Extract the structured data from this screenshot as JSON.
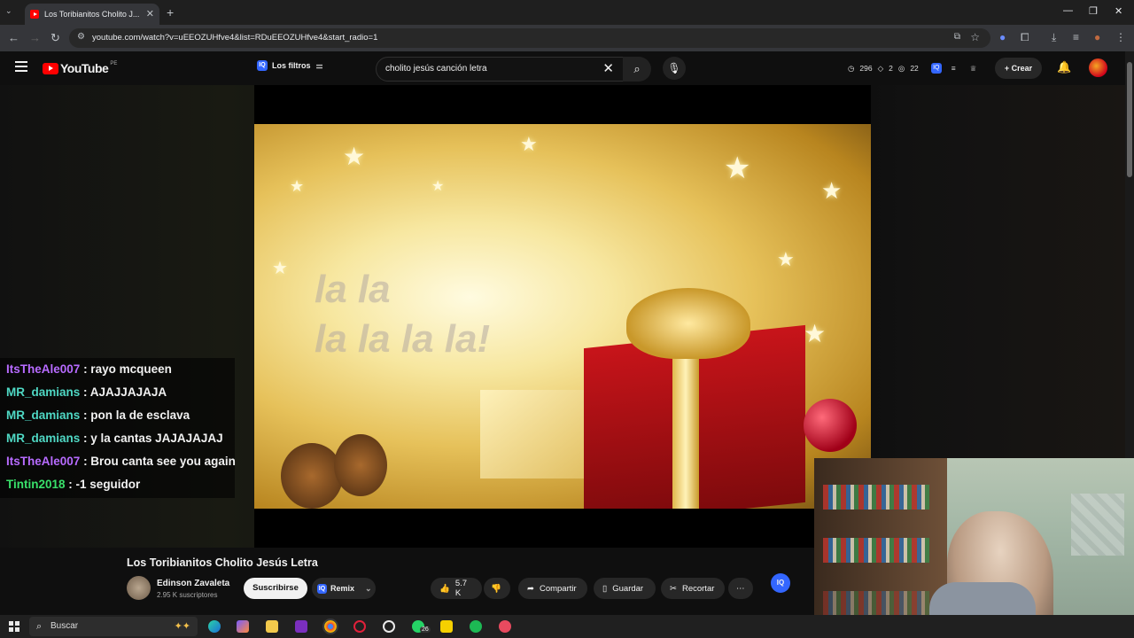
{
  "browser": {
    "tab_title": "Los Toribianitos Cholito J...",
    "url": "youtube.com/watch?v=uEEOZUHfve4&list=RDuEEOZUHfve4&start_radio=1",
    "window_controls": [
      "—",
      "❐",
      "✕"
    ]
  },
  "youtube": {
    "logo_text": "YouTube",
    "country_code": "PE",
    "filters_label": "Los filtros",
    "search_query": "cholito jesús canción letra",
    "stats": {
      "views": "296",
      "likes": "2",
      "comments": "22"
    },
    "create_label": "Crear"
  },
  "video": {
    "lyric_line_1": "la la",
    "lyric_line_2": "la la la la!",
    "title": "Los Toribianitos Cholito Jesús Letra",
    "channel_name": "Edinson Zavaleta",
    "subscribers": "2.95 K suscriptores",
    "subscribe_label": "Suscribirse",
    "remix_label": "Remix",
    "like_count": "5.7 K",
    "share_label": "Compartir",
    "save_label": "Guardar",
    "clip_label": "Recortar"
  },
  "chat": [
    {
      "user": "ItsTheAle007",
      "msg": ": rayo mcqueen",
      "color": "#b76bff"
    },
    {
      "user": "MR_damians",
      "msg": ": AJAJJAJAJA",
      "color": "#4fd8c4"
    },
    {
      "user": "MR_damians",
      "msg": ": pon la de esclava",
      "color": "#4fd8c4"
    },
    {
      "user": "MR_damians",
      "msg": ": y la cantas JAJAJAJAJ",
      "color": "#4fd8c4"
    },
    {
      "user": "ItsTheAle007",
      "msg": ": Brou canta see you again",
      "color": "#b76bff"
    },
    {
      "user": "Tintin2018",
      "msg": ": -1 seguidor",
      "color": "#39e06a"
    }
  ],
  "taskbar": {
    "search_placeholder": "Buscar",
    "whatsapp_badge": "26"
  },
  "colors": {
    "yt_red": "#ff0000",
    "accent_blue": "#3366ff"
  }
}
